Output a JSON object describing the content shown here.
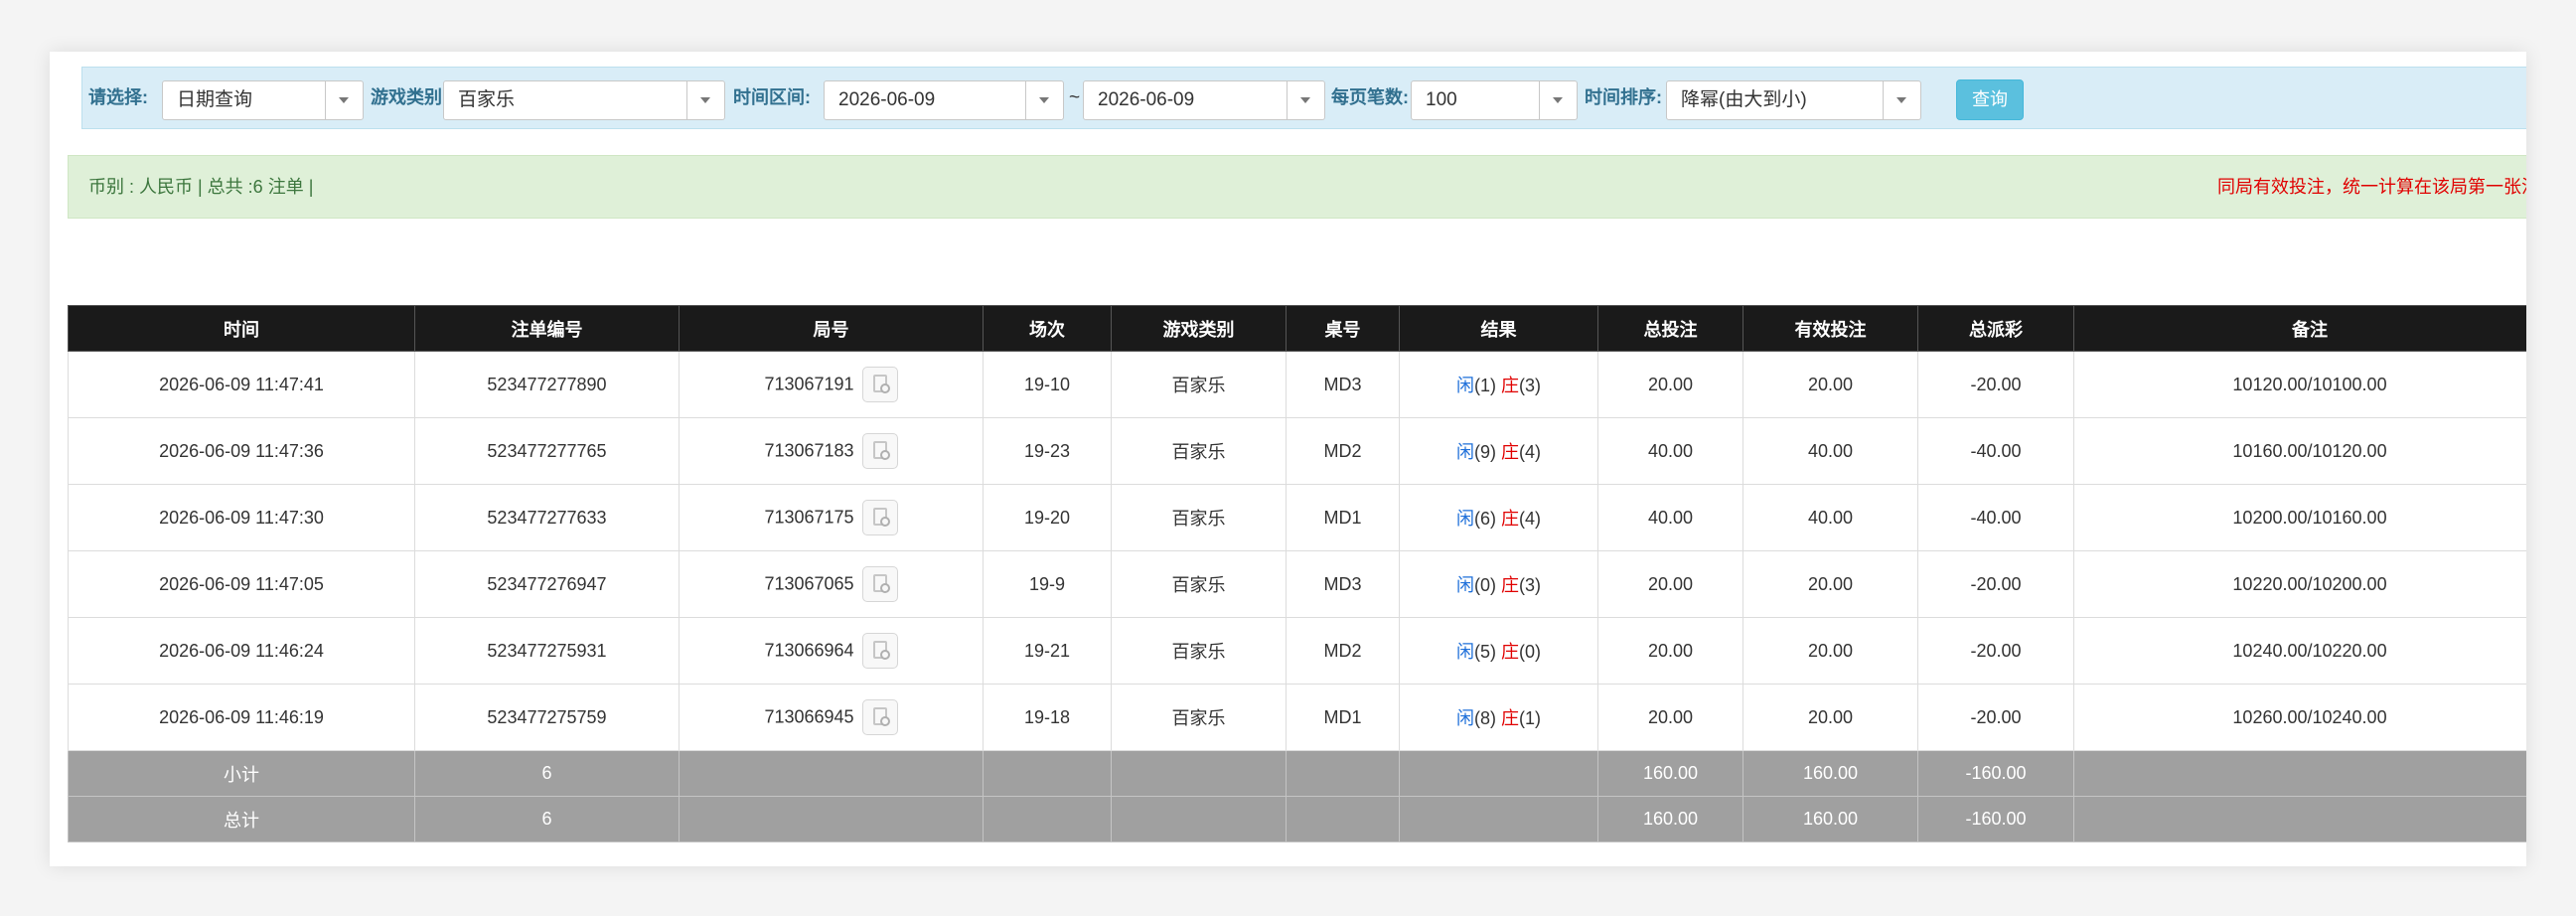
{
  "filters": {
    "select_label": "请选择:",
    "query_mode": "日期查询",
    "game_type_label": "游戏类别",
    "game_type": "百家乐",
    "time_range_label": "时间区间:",
    "date_from": "2026-06-09",
    "tilde": "~",
    "date_to": "2026-06-09",
    "per_page_label": "每页笔数:",
    "per_page": "100",
    "sort_label": "时间排序:",
    "sort": "降幂(由大到小)",
    "query_button": "查询"
  },
  "info": {
    "summary": "币别 : 人民币 | 总共 :6 注单 |",
    "notice": "同局有效投注，统一计算在该局第一张注单"
  },
  "colors": {
    "player": "#1e6fd9",
    "banker": "#e00000",
    "header_bg": "#1a1a1a",
    "summary_bg": "#a0a0a0"
  },
  "table": {
    "headers": [
      "时间",
      "注单编号",
      "局号",
      "场次",
      "游戏类别",
      "桌号",
      "结果",
      "总投注",
      "有效投注",
      "总派彩",
      "备注"
    ],
    "rows": [
      {
        "time": "2026-06-09 11:47:41",
        "bet_id": "523477277890",
        "round": "713067191",
        "session": "19-10",
        "game": "百家乐",
        "table": "MD3",
        "player_label": "闲",
        "player_score": "(1)",
        "banker_label": "庄",
        "banker_score": "(3)",
        "total_bet": "20.00",
        "valid_bet": "20.00",
        "payout": "-20.00",
        "remark": "10120.00/10100.00"
      },
      {
        "time": "2026-06-09 11:47:36",
        "bet_id": "523477277765",
        "round": "713067183",
        "session": "19-23",
        "game": "百家乐",
        "table": "MD2",
        "player_label": "闲",
        "player_score": "(9)",
        "banker_label": "庄",
        "banker_score": "(4)",
        "total_bet": "40.00",
        "valid_bet": "40.00",
        "payout": "-40.00",
        "remark": "10160.00/10120.00"
      },
      {
        "time": "2026-06-09 11:47:30",
        "bet_id": "523477277633",
        "round": "713067175",
        "session": "19-20",
        "game": "百家乐",
        "table": "MD1",
        "player_label": "闲",
        "player_score": "(6)",
        "banker_label": "庄",
        "banker_score": "(4)",
        "total_bet": "40.00",
        "valid_bet": "40.00",
        "payout": "-40.00",
        "remark": "10200.00/10160.00"
      },
      {
        "time": "2026-06-09 11:47:05",
        "bet_id": "523477276947",
        "round": "713067065",
        "session": "19-9",
        "game": "百家乐",
        "table": "MD3",
        "player_label": "闲",
        "player_score": "(0)",
        "banker_label": "庄",
        "banker_score": "(3)",
        "total_bet": "20.00",
        "valid_bet": "20.00",
        "payout": "-20.00",
        "remark": "10220.00/10200.00"
      },
      {
        "time": "2026-06-09 11:46:24",
        "bet_id": "523477275931",
        "round": "713066964",
        "session": "19-21",
        "game": "百家乐",
        "table": "MD2",
        "player_label": "闲",
        "player_score": "(5)",
        "banker_label": "庄",
        "banker_score": "(0)",
        "total_bet": "20.00",
        "valid_bet": "20.00",
        "payout": "-20.00",
        "remark": "10240.00/10220.00"
      },
      {
        "time": "2026-06-09 11:46:19",
        "bet_id": "523477275759",
        "round": "713066945",
        "session": "19-18",
        "game": "百家乐",
        "table": "MD1",
        "player_label": "闲",
        "player_score": "(8)",
        "banker_label": "庄",
        "banker_score": "(1)",
        "total_bet": "20.00",
        "valid_bet": "20.00",
        "payout": "-20.00",
        "remark": "10260.00/10240.00"
      }
    ],
    "subtotal": {
      "label": "小计",
      "count": "6",
      "total_bet": "160.00",
      "valid_bet": "160.00",
      "payout": "-160.00"
    },
    "grand_total": {
      "label": "总计",
      "count": "6",
      "total_bet": "160.00",
      "valid_bet": "160.00",
      "payout": "-160.00"
    }
  }
}
